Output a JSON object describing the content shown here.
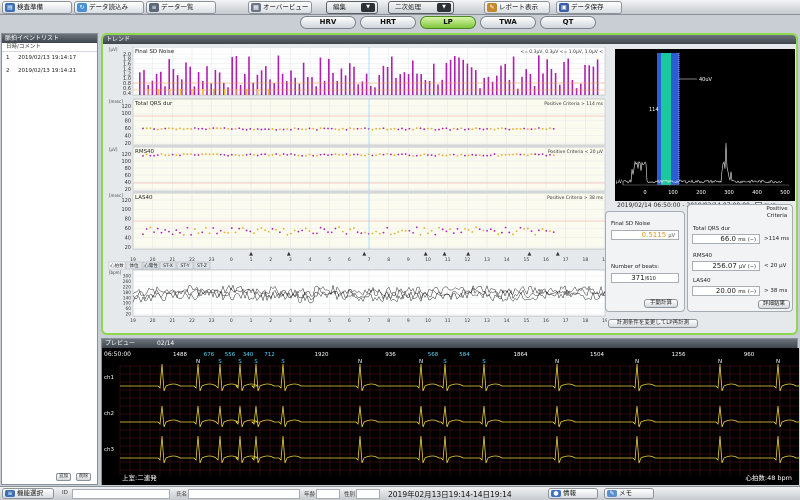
{
  "toolbar": {
    "exam_prep": "検査準備",
    "data_load": "データ読込み",
    "data_list": "データ一覧",
    "overview": "オーバービュー",
    "edit": "編集",
    "secondary": "二次処理",
    "report": "レポート表示",
    "save": "データ保存"
  },
  "tabs": [
    {
      "label": "HRV",
      "active": false
    },
    {
      "label": "HRT",
      "active": false
    },
    {
      "label": "LP",
      "active": true
    },
    {
      "label": "TWA",
      "active": false
    },
    {
      "label": "QT",
      "active": false
    }
  ],
  "event_list": {
    "title": "脈拍イベントリスト",
    "header": "日時/コメント",
    "rows": [
      {
        "no": "1",
        "datetime": "2019/02/13 19:14:17"
      },
      {
        "no": "2",
        "datetime": "2019/02/13 19:14:21"
      }
    ],
    "add_btn": "追加",
    "del_btn": "削除"
  },
  "trend": {
    "title": "トレンド",
    "panels": [
      {
        "unit": "[μV]",
        "title": "Final SD Noise",
        "criteria": "<= 0.3μV, 0.3μV <= 1.0μV, 1.0μV <",
        "ticks": [
          "2.0",
          "1.8",
          "1.6",
          "1.4",
          "1.2",
          "1.0",
          "0.8",
          "0.6",
          "0.4"
        ]
      },
      {
        "unit": "[msec]",
        "title": "Total QRS dur",
        "criteria": "Positive Criteria > 114 ms",
        "ticks": [
          "120",
          "100",
          "80",
          "60",
          "40",
          "20"
        ]
      },
      {
        "unit": "[μV]",
        "title": "RMS40",
        "criteria": "Positive Criteria < 20 μV",
        "ticks": [
          "120",
          "100",
          "80",
          "60",
          "40",
          "20"
        ]
      },
      {
        "unit": "[msec]",
        "title": "LAS40",
        "criteria": "Positive Criteria > 38 ms",
        "ticks": [
          "120",
          "100",
          "80",
          "60",
          "40",
          "20"
        ]
      }
    ],
    "x_ticks": [
      "19",
      "20",
      "21",
      "22",
      "23",
      "0",
      "1",
      "2",
      "3",
      "4",
      "5",
      "6",
      "7",
      "8",
      "9",
      "10",
      "11",
      "12",
      "13",
      "14",
      "15",
      "16",
      "17",
      "18",
      "19"
    ],
    "hr_tabs": [
      "心拍数",
      "体位",
      "心電性",
      "ST-X",
      "ST-Y",
      "ST-Z"
    ],
    "hr_unit": "[bpm]",
    "hr_ticks": [
      "300",
      "260",
      "220",
      "180",
      "140",
      "100",
      "60",
      "20"
    ],
    "side_chart": {
      "label_40uv": "40uV",
      "label_114": "114",
      "label_uv": "μV",
      "x_ticks": [
        "0",
        "100",
        "200",
        "300",
        "400",
        "500"
      ],
      "time_range": "2019/02/14 06:50:00 - 2019/02/14 07:00:00",
      "register": "登録"
    },
    "results": {
      "final_sd_noise_label": "Final SD Noise",
      "final_sd_noise_value": "0.5115",
      "final_sd_noise_unit": "μV",
      "beats_label": "Number of beats:",
      "beats_value": "371",
      "beats_total": "/610",
      "manual_calc": "手動計算",
      "positive_criteria": "Positive Criteria",
      "total_qrs_label": "Total QRS dur",
      "total_qrs_value": "66.0",
      "total_qrs_unit": "ms",
      "total_qrs_flag": "(−)",
      "total_qrs_crit": ">114 ms",
      "rms40_label": "RMS40",
      "rms40_value": "256.07",
      "rms40_unit": "μV",
      "rms40_flag": "(−)",
      "rms40_crit": "< 20 μV",
      "las40_label": "LAS40",
      "las40_value": "20.00",
      "las40_unit": "ms",
      "las40_flag": "(−)",
      "las40_crit": "> 38 ms",
      "detail_result": "詳細結果",
      "recalc_button": "計測条件を変更してLP再計測"
    }
  },
  "preview": {
    "title": "プレビュー",
    "page": "02/14",
    "time": "06:50:00",
    "beats": [
      {
        "rr": "1488",
        "cls": "N",
        "abn": false
      },
      {
        "rr": "676",
        "cls": "S",
        "abn": true
      },
      {
        "rr": "556",
        "cls": "S",
        "abn": true
      },
      {
        "rr": "340",
        "cls": "S",
        "abn": true
      },
      {
        "rr": "712",
        "cls": "S",
        "abn": true
      },
      {
        "rr": "1920",
        "cls": "N",
        "abn": false
      },
      {
        "rr": "936",
        "cls": "N",
        "abn": false
      },
      {
        "rr": "568",
        "cls": "S",
        "abn": true
      },
      {
        "rr": "584",
        "cls": "S",
        "abn": true
      },
      {
        "rr": "1864",
        "cls": "N",
        "abn": false
      },
      {
        "rr": "1504",
        "cls": "N",
        "abn": false
      },
      {
        "rr": "1256",
        "cls": "N",
        "abn": false
      },
      {
        "rr": "960",
        "cls": "N",
        "abn": false
      }
    ],
    "channels": [
      "ch1",
      "ch2",
      "ch3"
    ],
    "event_note": "上室:二連発",
    "heart_rate": "心拍数:48 bpm"
  },
  "statusbar": {
    "function_select": "機能選択",
    "id_label": "ID",
    "name_label": "氏名",
    "age_label": "年齢",
    "sex_label": "性別",
    "date_range": "2019年02月13日19:14-14日19:14",
    "info": "情報",
    "memo": "メモ"
  },
  "colors": {
    "noise_bar": "#b020b0",
    "trend_frame": "#8fd84d",
    "ecg_trace": "#e6d23c",
    "side_peak": "#18c8a0",
    "side_band": "#2c5dd6"
  }
}
